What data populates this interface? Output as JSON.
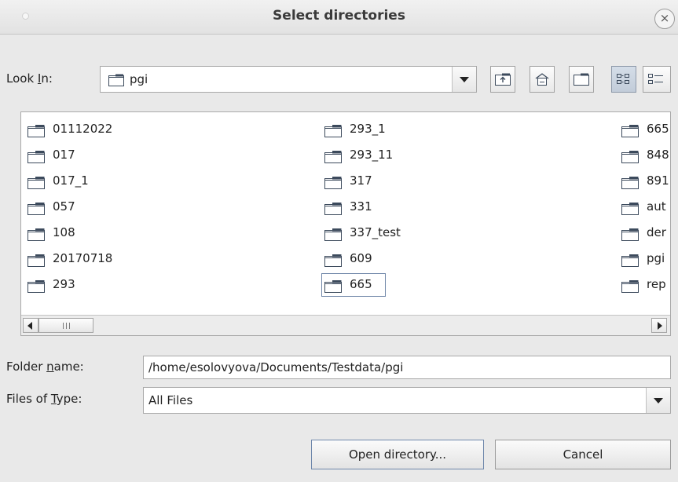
{
  "window": {
    "title": "Select directories",
    "close_glyph": "×"
  },
  "look_in": {
    "label_pre": "Look ",
    "label_mnemonic": "I",
    "label_post": "n:",
    "value": "pgi"
  },
  "toolbar": {
    "icons": [
      "up-folder-icon",
      "home-icon",
      "new-folder-icon",
      "list-view-icon",
      "details-view-icon"
    ]
  },
  "file_list": {
    "columns": [
      [
        "01112022",
        "017",
        "017_1",
        "057",
        "108",
        "20170718",
        "293"
      ],
      [
        "293_1",
        "293_11",
        "317",
        "331",
        "337_test",
        "609",
        "665"
      ],
      [
        "665",
        "848",
        "891",
        "aut",
        "der",
        "pgi",
        "rep"
      ]
    ],
    "focused_item": "665"
  },
  "folder_name": {
    "label_pre": "Folder ",
    "label_mnemonic": "n",
    "label_post": "ame:",
    "value": "/home/esolovyova/Documents/Testdata/pgi"
  },
  "files_of_type": {
    "label_pre": "Files of ",
    "label_mnemonic": "T",
    "label_post": "ype:",
    "value": "All Files"
  },
  "buttons": {
    "open": "Open directory...",
    "cancel": "Cancel"
  }
}
